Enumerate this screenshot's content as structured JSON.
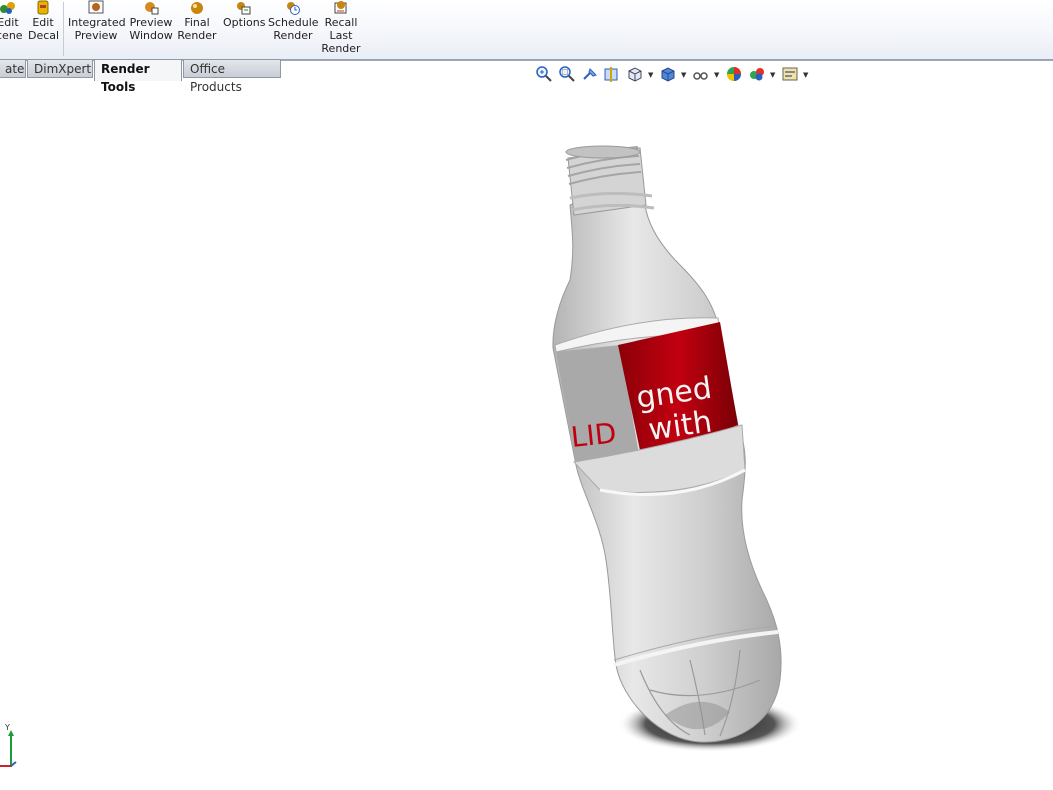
{
  "ribbon": {
    "buttons": [
      {
        "id": "edit-scene",
        "label": "Edit\nScene",
        "visible_label": "Edit\ncene"
      },
      {
        "id": "edit-decal",
        "label": "Edit\nDecal"
      },
      {
        "id": "integrated-preview",
        "label": "Integrated\nPreview"
      },
      {
        "id": "preview-window",
        "label": "Preview\nWindow"
      },
      {
        "id": "final-render",
        "label": "Final\nRender"
      },
      {
        "id": "options",
        "label": "Options"
      },
      {
        "id": "schedule-render",
        "label": "Schedule\nRender"
      },
      {
        "id": "recall-last-render",
        "label": "Recall\nLast\nRender"
      }
    ]
  },
  "tabs": [
    {
      "label": "ate"
    },
    {
      "label": "DimXpert"
    },
    {
      "label": "Render Tools",
      "active": true
    },
    {
      "label": "Office Products"
    }
  ],
  "hud_icons": [
    "zoom-to-fit-icon",
    "zoom-area-icon",
    "previous-view-icon",
    "section-view-icon",
    "view-orientation-icon",
    "display-style-icon",
    "hide-show-icon",
    "edit-appearance-icon",
    "apply-scene-icon",
    "view-settings-icon"
  ],
  "label_text": {
    "line1": "gned",
    "line2": "with",
    "left_fragment": "LID"
  },
  "triad": {
    "axis_y": "Y"
  },
  "colors": {
    "label_red": "#b3000c",
    "bottle": "#d7d7d7",
    "ribbon_border": "#9aa6b8"
  }
}
